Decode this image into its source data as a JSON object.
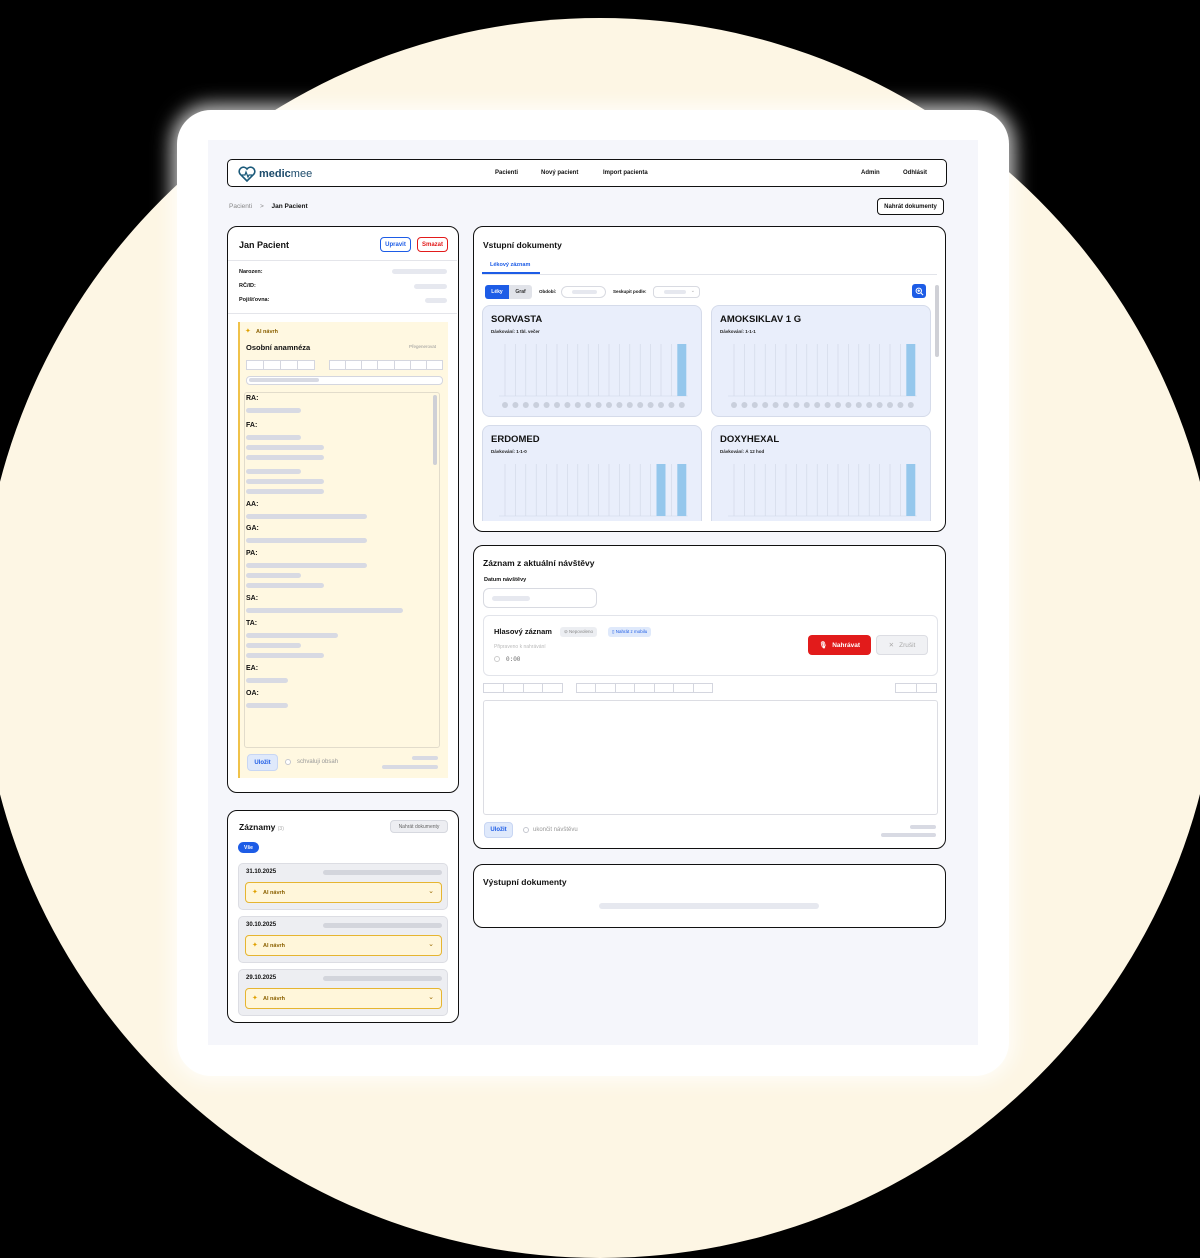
{
  "app": {
    "logo_strong": "medic",
    "logo_light": "mee"
  },
  "nav": {
    "pacienti": "Pacienti",
    "novy": "Nový pacient",
    "import": "Import pacienta",
    "admin": "Admin",
    "logout": "Odhlásit"
  },
  "breadcrumb": {
    "root": "Pacienti",
    "sep": ">",
    "current": "Jan Pacient"
  },
  "upload_button": "Nahrát dokumenty",
  "patient": {
    "name": "Jan Pacient",
    "edit": "Upravit",
    "delete": "Smazat",
    "fields": {
      "born": "Narozen:",
      "rc": "RČ/ID:",
      "insurance": "Pojišťovna:"
    }
  },
  "ai_panel": {
    "star": "✦",
    "badge": "AI návrh",
    "title": "Osobní anamnéza",
    "regen": "Přegenerovat",
    "sections": [
      "RA:",
      "FA:",
      "AA:",
      "GA:",
      "PA:",
      "SA:",
      "TA:",
      "EA:",
      "OA:"
    ],
    "save": "Uložit",
    "approve": "schvaluji obsah"
  },
  "records": {
    "title": "Záznamy",
    "count": "(3)",
    "upload": "Nahrát dokumenty",
    "filter_all": "Vše",
    "items": [
      {
        "date": "31.10.2025",
        "ai": "AI návrh"
      },
      {
        "date": "30.10.2025",
        "ai": "AI návrh"
      },
      {
        "date": "29.10.2025",
        "ai": "AI návrh"
      }
    ]
  },
  "input_docs": {
    "title": "Vstupní dokumenty",
    "tab": "Lékový záznam",
    "toggle_drugs": "Léky",
    "toggle_graph": "Graf",
    "period_label": "Období:",
    "group_label": "Seskupit podle:",
    "zoom_icon": "zoom-in-icon"
  },
  "chart_data": [
    {
      "type": "bar",
      "title": "SORVASTA",
      "subtitle": "Dávkování: 1 tbl. večer",
      "values": [
        0,
        0,
        0,
        0,
        0,
        0,
        0,
        0,
        0,
        0,
        0,
        0,
        0,
        0,
        0,
        0,
        0,
        1
      ]
    },
    {
      "type": "bar",
      "title": "AMOKSIKLAV 1 G",
      "subtitle": "Dávkování: 1-1-1",
      "values": [
        0,
        0,
        0,
        0,
        0,
        0,
        0,
        0,
        0,
        0,
        0,
        0,
        0,
        0,
        0,
        0,
        0,
        1
      ]
    },
    {
      "type": "bar",
      "title": "ERDOMED",
      "subtitle": "Dávkování: 1-1-0",
      "values": [
        0,
        0,
        0,
        0,
        0,
        0,
        0,
        0,
        0,
        0,
        0,
        0,
        0,
        0,
        0,
        1,
        0,
        1
      ]
    },
    {
      "type": "bar",
      "title": "DOXYHEXAL",
      "subtitle": "Dávkování: Á 12 hod",
      "values": [
        0,
        0,
        0,
        0,
        0,
        0,
        0,
        0,
        0,
        0,
        0,
        0,
        0,
        0,
        0,
        0,
        0,
        1
      ]
    }
  ],
  "visit": {
    "title": "Záznam z aktuální návštěvy",
    "date_label": "Datum návštěvy",
    "voice_title": "Hlasový záznam",
    "status_chip": "Nepovoleno",
    "mobile_chip": "Nahrát z mobilu",
    "ready_text": "Připraveno k nahrávání",
    "timer": "0:00",
    "record_btn": "Nahrávat",
    "cancel_btn": "Zrušit",
    "save": "Uložit",
    "finish": "ukončit návštěvu"
  },
  "output_docs": {
    "title": "Výstupní dokumenty"
  },
  "colors": {
    "accent": "#1d5ce6",
    "danger": "#e21b1b",
    "ai_bg": "#fff8e1",
    "bar": "#95c7ec"
  }
}
